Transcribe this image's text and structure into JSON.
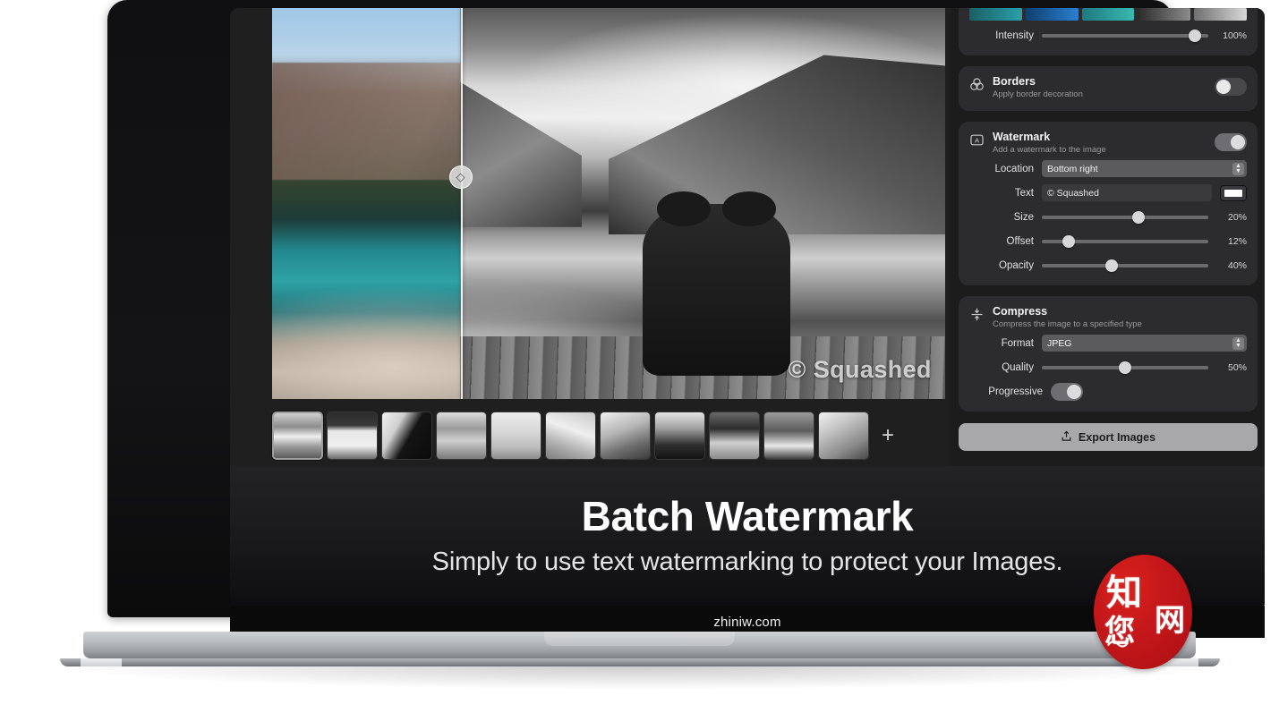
{
  "site": {
    "url": "zhiniw.com"
  },
  "promo": {
    "headline": "Batch Watermark",
    "subhead": "Simply to use text watermarking to protect your Images."
  },
  "preview": {
    "watermark_overlay": "© Squashed",
    "split_handle_icon": "◇",
    "split_position_pct": 28
  },
  "thumbnails": {
    "count": 11,
    "selected_index": 0,
    "add_label": "+",
    "items": [
      {
        "name": "thumb-lake-couple",
        "selected": true
      },
      {
        "name": "thumb-gallery-frame",
        "selected": false
      },
      {
        "name": "thumb-portrait-dark",
        "selected": false
      },
      {
        "name": "thumb-street-crowd",
        "selected": false
      },
      {
        "name": "thumb-bride-indoor",
        "selected": false
      },
      {
        "name": "thumb-bride-veil",
        "selected": false
      },
      {
        "name": "thumb-couple-kiss",
        "selected": false
      },
      {
        "name": "thumb-woman-portrait",
        "selected": false
      },
      {
        "name": "thumb-alley-trees",
        "selected": false
      },
      {
        "name": "thumb-car-street",
        "selected": false
      },
      {
        "name": "thumb-bride-closeup",
        "selected": false
      }
    ]
  },
  "sidebar": {
    "filters": {
      "intensity_label": "Intensity",
      "intensity_value": "100%",
      "intensity_pct": 92
    },
    "borders": {
      "icon": "venn-circles-icon",
      "title": "Borders",
      "subtitle": "Apply border decoration",
      "enabled": false
    },
    "watermark": {
      "icon": "letter-a-box-icon",
      "title": "Watermark",
      "subtitle": "Add a watermark to the image",
      "enabled": true,
      "fields": {
        "location_label": "Location",
        "location_value": "Bottom right",
        "text_label": "Text",
        "text_value": "© Squashed",
        "color_swatch": "#ffffff",
        "size_label": "Size",
        "size_value": "20%",
        "size_pct": 58,
        "offset_label": "Offset",
        "offset_value": "12%",
        "offset_pct": 16,
        "opacity_label": "Opacity",
        "opacity_value": "40%",
        "opacity_pct": 42
      }
    },
    "compress": {
      "icon": "compress-arrows-icon",
      "title": "Compress",
      "subtitle": "Compress the image to a specified type",
      "fields": {
        "format_label": "Format",
        "format_value": "JPEG",
        "quality_label": "Quality",
        "quality_value": "50%",
        "quality_pct": 50,
        "progressive_label": "Progressive",
        "progressive_enabled": true
      }
    },
    "export": {
      "icon": "export-upload-icon",
      "label": "Export Images"
    }
  },
  "seal": {
    "char1": "知",
    "char2": "网",
    "char3": "您",
    "wave": "〜"
  }
}
